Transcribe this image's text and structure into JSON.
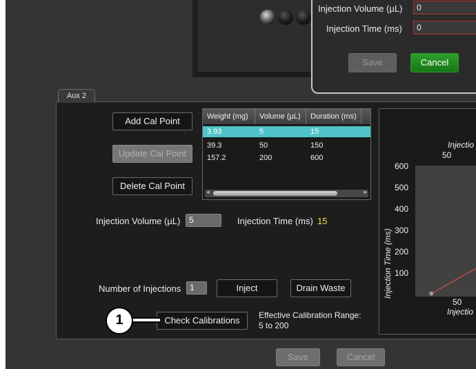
{
  "modal": {
    "volume_label": "Injection Volume (µL)",
    "volume_value": "0",
    "time_label": "Injection Time (ms)",
    "time_value": "0",
    "save_label": "Save",
    "cancel_label": "Cancel"
  },
  "tab": {
    "label": "Aux 2"
  },
  "buttons": {
    "add_cal_point": "Add Cal Point",
    "update_cal_point": "Update Cal Point",
    "delete_cal_point": "Delete Cal Point",
    "inject": "Inject",
    "drain_waste": "Drain Waste",
    "check_calibrations": "Check Calibrations"
  },
  "table": {
    "headers": [
      "Weight (mg)",
      "Volume (µL)",
      "Duration (ms)"
    ],
    "rows": [
      {
        "weight": "3.93",
        "volume": "5",
        "duration": "15"
      },
      {
        "weight": "39.3",
        "volume": "50",
        "duration": "150"
      },
      {
        "weight": "157.2",
        "volume": "200",
        "duration": "600"
      }
    ]
  },
  "form": {
    "injection_volume_label": "Injection Volume (µL)",
    "injection_volume_value": "5",
    "injection_time_label": "Injection Time (ms)",
    "injection_time_value": "15",
    "num_injections_label": "Number of Injections",
    "num_injections_value": "1",
    "range_label": "Effective Calibration Range:",
    "range_value": "5 to 200"
  },
  "chart": {
    "title_partial": "Injectio",
    "top_tick": "50",
    "y_ticks": [
      "600",
      "500",
      "400",
      "300",
      "200",
      "100"
    ],
    "x_tick": "50",
    "x_title_partial": "Injectio",
    "y_title": "Injection Time (ms)"
  },
  "chart_data": {
    "type": "line",
    "x": [
      5,
      50,
      200
    ],
    "series": [
      {
        "values": [
          15,
          150,
          600
        ]
      }
    ],
    "ylim": [
      0,
      650
    ]
  },
  "bottom": {
    "save_label": "Save",
    "cancel_label": "Cancel"
  },
  "callout": {
    "number": "1"
  },
  "colors": {
    "accent_selected_row": "#4fc3c9",
    "cancel_green": "#1f8a20",
    "highlight_yellow": "#f0e040"
  }
}
